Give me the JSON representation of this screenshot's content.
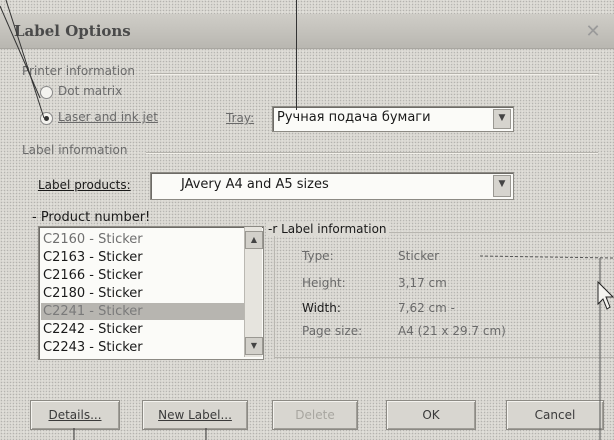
{
  "dialog": {
    "title": "Label Options",
    "close_glyph": "✕"
  },
  "printer": {
    "section_label": "Printer information",
    "dot_matrix_label": "Dot matrix",
    "laser_label": "Laser and ink jet",
    "tray_label": "Tray:",
    "tray_value": "Ручная подача бумаги"
  },
  "label_info": {
    "section_label": "Label information",
    "products_label": "Label products:",
    "products_value": "JAvery A4 and A5 sizes"
  },
  "product_number": {
    "label": "- Product number!",
    "items": [
      "C2160 - Sticker",
      "C2163 - Sticker",
      "C2166 - Sticker",
      "C2180 - Sticker",
      "C2241 - Sticker",
      "C2242 - Sticker",
      "C2243 - Sticker"
    ],
    "selected_index": 4
  },
  "label_details": {
    "group_label": "-r Label information",
    "type_label": "Type:",
    "type_value": "Sticker",
    "height_label": "Height:",
    "height_value": "3,17 cm",
    "width_label": "Width:",
    "width_value": "7,62 cm -",
    "page_size_label": "Page size:",
    "page_size_value": "A4 (21 x 29.7 cm)"
  },
  "buttons": {
    "details": "Details...",
    "new_label": "New Label...",
    "delete": "Delete",
    "ok": "OK",
    "cancel": "Cancel"
  }
}
